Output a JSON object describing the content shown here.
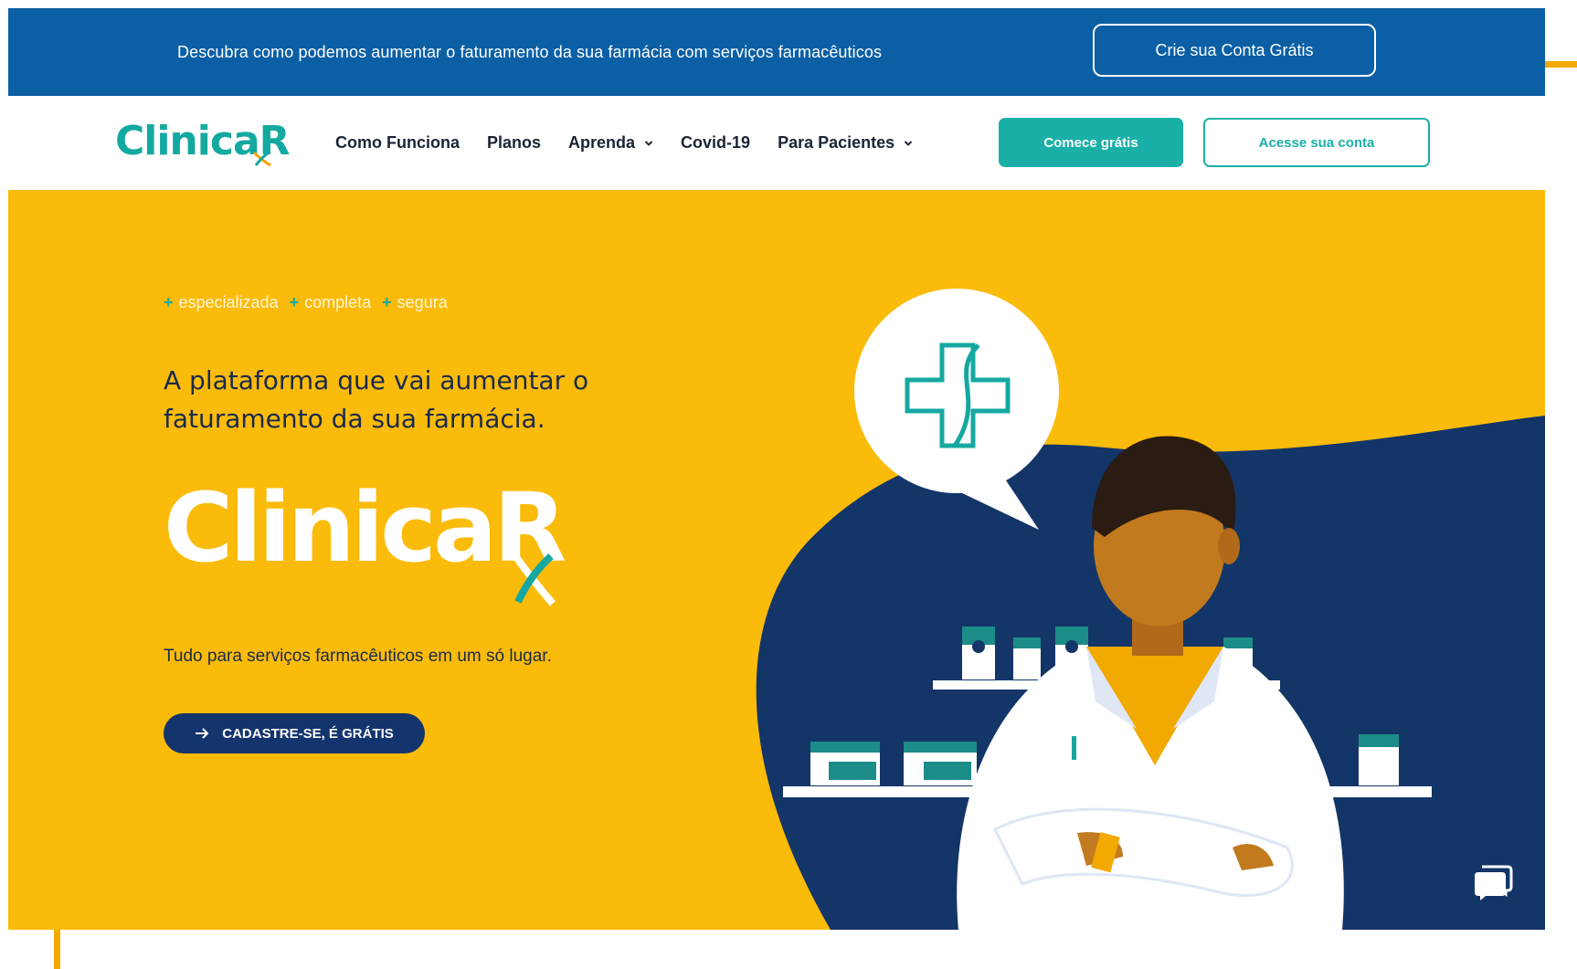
{
  "colors": {
    "banner_blue": "#0b5fa5",
    "teal": "#1ab0a8",
    "hero_yellow": "#fbbb0a",
    "navy": "#14346e",
    "accent_orange": "#f2a900"
  },
  "banner": {
    "text": "Descubra como podemos aumentar o faturamento da sua farmácia com serviços farmacêuticos",
    "button_label": "Crie sua Conta Grátis"
  },
  "nav": {
    "logo_text": "ClinicaR",
    "links": [
      {
        "label": "Como Funciona",
        "has_dropdown": false
      },
      {
        "label": "Planos",
        "has_dropdown": false
      },
      {
        "label": "Aprenda",
        "has_dropdown": true
      },
      {
        "label": "Covid-19",
        "has_dropdown": false
      },
      {
        "label": "Para Pacientes",
        "has_dropdown": true
      }
    ],
    "start_button": "Comece grátis",
    "account_button": "Acesse sua conta"
  },
  "hero": {
    "tags": [
      "especializada",
      "completa",
      "segura"
    ],
    "headline": "A plataforma que vai aumentar o faturamento da sua farmácia.",
    "brand_text": "ClinicaR",
    "subline": "Tudo para serviços farmacêuticos em um só lugar.",
    "cta_label": "CADASTRE-SE, É GRÁTIS",
    "cta_icon": "arrow-right-icon",
    "illustration": "pharmacist-illustration",
    "chat_icon": "chat-bubble-icon"
  }
}
